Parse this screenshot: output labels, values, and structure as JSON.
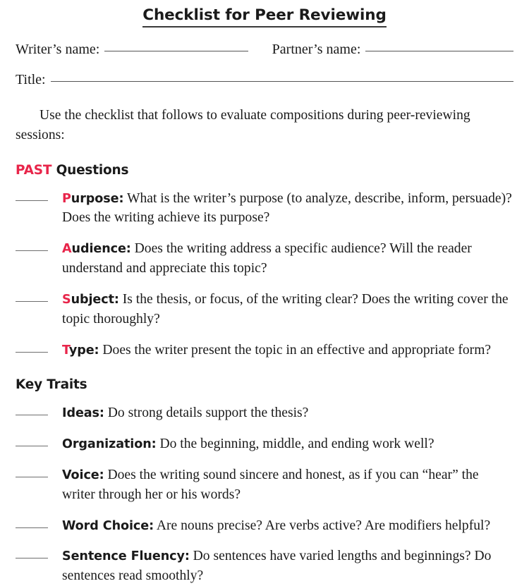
{
  "title": "Checklist for Peer Reviewing",
  "accent_color": "#e8254a",
  "form": {
    "writer_label": "Writer’s name:",
    "partner_label": "Partner’s name:",
    "title_label": "Title:"
  },
  "intro": "Use the checklist that follows to evaluate compositions during peer-reviewing sessions:",
  "sections": [
    {
      "heading_accent": "PAST",
      "heading_rest": " Questions",
      "items": [
        {
          "initial": "P",
          "label_rest": "urpose:",
          "question": " What is the writer’s purpose (to analyze, describe, inform, persuade)? Does the writing achieve its purpose?"
        },
        {
          "initial": "A",
          "label_rest": "udience:",
          "question": " Does the writing address a specific audience? Will the reader understand and appreciate this topic?"
        },
        {
          "initial": "S",
          "label_rest": "ubject:",
          "question": " Is the thesis, or focus, of the writing clear? Does the writing cover the topic thoroughly?"
        },
        {
          "initial": "T",
          "label_rest": "ype:",
          "question": " Does the writer present the topic in an effective and appropriate form?"
        }
      ]
    },
    {
      "heading_accent": "",
      "heading_rest": "Key Traits",
      "items": [
        {
          "initial": "",
          "label_rest": "Ideas:",
          "question": " Do strong details support the thesis?"
        },
        {
          "initial": "",
          "label_rest": "Organization:",
          "question": " Do the beginning, middle, and ending work well?"
        },
        {
          "initial": "",
          "label_rest": "Voice:",
          "question": " Does the writing sound sincere and honest, as if you can “hear” the writer through her or his words?"
        },
        {
          "initial": "",
          "label_rest": "Word Choice:",
          "question": " Are nouns precise? Are verbs active? Are modifiers helpful?"
        },
        {
          "initial": "",
          "label_rest": "Sentence Fluency:",
          "question": " Do sentences have varied lengths and beginnings? Do sentences read smoothly?"
        }
      ]
    }
  ]
}
